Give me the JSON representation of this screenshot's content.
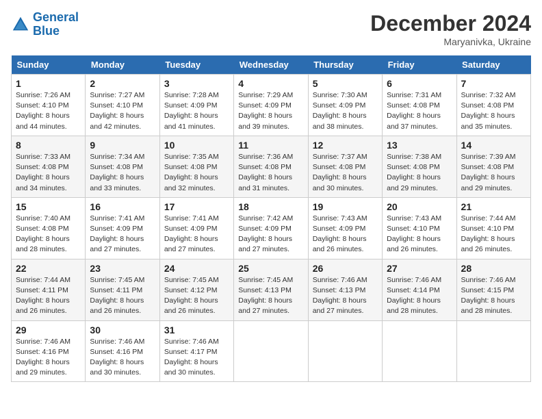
{
  "header": {
    "logo_line1": "General",
    "logo_line2": "Blue",
    "month_title": "December 2024",
    "subtitle": "Maryanivka, Ukraine"
  },
  "weekdays": [
    "Sunday",
    "Monday",
    "Tuesday",
    "Wednesday",
    "Thursday",
    "Friday",
    "Saturday"
  ],
  "weeks": [
    [
      {
        "day": "1",
        "sunrise": "7:26 AM",
        "sunset": "4:10 PM",
        "daylight": "8 hours and 44 minutes."
      },
      {
        "day": "2",
        "sunrise": "7:27 AM",
        "sunset": "4:10 PM",
        "daylight": "8 hours and 42 minutes."
      },
      {
        "day": "3",
        "sunrise": "7:28 AM",
        "sunset": "4:09 PM",
        "daylight": "8 hours and 41 minutes."
      },
      {
        "day": "4",
        "sunrise": "7:29 AM",
        "sunset": "4:09 PM",
        "daylight": "8 hours and 39 minutes."
      },
      {
        "day": "5",
        "sunrise": "7:30 AM",
        "sunset": "4:09 PM",
        "daylight": "8 hours and 38 minutes."
      },
      {
        "day": "6",
        "sunrise": "7:31 AM",
        "sunset": "4:08 PM",
        "daylight": "8 hours and 37 minutes."
      },
      {
        "day": "7",
        "sunrise": "7:32 AM",
        "sunset": "4:08 PM",
        "daylight": "8 hours and 35 minutes."
      }
    ],
    [
      {
        "day": "8",
        "sunrise": "7:33 AM",
        "sunset": "4:08 PM",
        "daylight": "8 hours and 34 minutes."
      },
      {
        "day": "9",
        "sunrise": "7:34 AM",
        "sunset": "4:08 PM",
        "daylight": "8 hours and 33 minutes."
      },
      {
        "day": "10",
        "sunrise": "7:35 AM",
        "sunset": "4:08 PM",
        "daylight": "8 hours and 32 minutes."
      },
      {
        "day": "11",
        "sunrise": "7:36 AM",
        "sunset": "4:08 PM",
        "daylight": "8 hours and 31 minutes."
      },
      {
        "day": "12",
        "sunrise": "7:37 AM",
        "sunset": "4:08 PM",
        "daylight": "8 hours and 30 minutes."
      },
      {
        "day": "13",
        "sunrise": "7:38 AM",
        "sunset": "4:08 PM",
        "daylight": "8 hours and 29 minutes."
      },
      {
        "day": "14",
        "sunrise": "7:39 AM",
        "sunset": "4:08 PM",
        "daylight": "8 hours and 29 minutes."
      }
    ],
    [
      {
        "day": "15",
        "sunrise": "7:40 AM",
        "sunset": "4:08 PM",
        "daylight": "8 hours and 28 minutes."
      },
      {
        "day": "16",
        "sunrise": "7:41 AM",
        "sunset": "4:09 PM",
        "daylight": "8 hours and 27 minutes."
      },
      {
        "day": "17",
        "sunrise": "7:41 AM",
        "sunset": "4:09 PM",
        "daylight": "8 hours and 27 minutes."
      },
      {
        "day": "18",
        "sunrise": "7:42 AM",
        "sunset": "4:09 PM",
        "daylight": "8 hours and 27 minutes."
      },
      {
        "day": "19",
        "sunrise": "7:43 AM",
        "sunset": "4:09 PM",
        "daylight": "8 hours and 26 minutes."
      },
      {
        "day": "20",
        "sunrise": "7:43 AM",
        "sunset": "4:10 PM",
        "daylight": "8 hours and 26 minutes."
      },
      {
        "day": "21",
        "sunrise": "7:44 AM",
        "sunset": "4:10 PM",
        "daylight": "8 hours and 26 minutes."
      }
    ],
    [
      {
        "day": "22",
        "sunrise": "7:44 AM",
        "sunset": "4:11 PM",
        "daylight": "8 hours and 26 minutes."
      },
      {
        "day": "23",
        "sunrise": "7:45 AM",
        "sunset": "4:11 PM",
        "daylight": "8 hours and 26 minutes."
      },
      {
        "day": "24",
        "sunrise": "7:45 AM",
        "sunset": "4:12 PM",
        "daylight": "8 hours and 26 minutes."
      },
      {
        "day": "25",
        "sunrise": "7:45 AM",
        "sunset": "4:13 PM",
        "daylight": "8 hours and 27 minutes."
      },
      {
        "day": "26",
        "sunrise": "7:46 AM",
        "sunset": "4:13 PM",
        "daylight": "8 hours and 27 minutes."
      },
      {
        "day": "27",
        "sunrise": "7:46 AM",
        "sunset": "4:14 PM",
        "daylight": "8 hours and 28 minutes."
      },
      {
        "day": "28",
        "sunrise": "7:46 AM",
        "sunset": "4:15 PM",
        "daylight": "8 hours and 28 minutes."
      }
    ],
    [
      {
        "day": "29",
        "sunrise": "7:46 AM",
        "sunset": "4:16 PM",
        "daylight": "8 hours and 29 minutes."
      },
      {
        "day": "30",
        "sunrise": "7:46 AM",
        "sunset": "4:16 PM",
        "daylight": "8 hours and 30 minutes."
      },
      {
        "day": "31",
        "sunrise": "7:46 AM",
        "sunset": "4:17 PM",
        "daylight": "8 hours and 30 minutes."
      },
      null,
      null,
      null,
      null
    ]
  ]
}
